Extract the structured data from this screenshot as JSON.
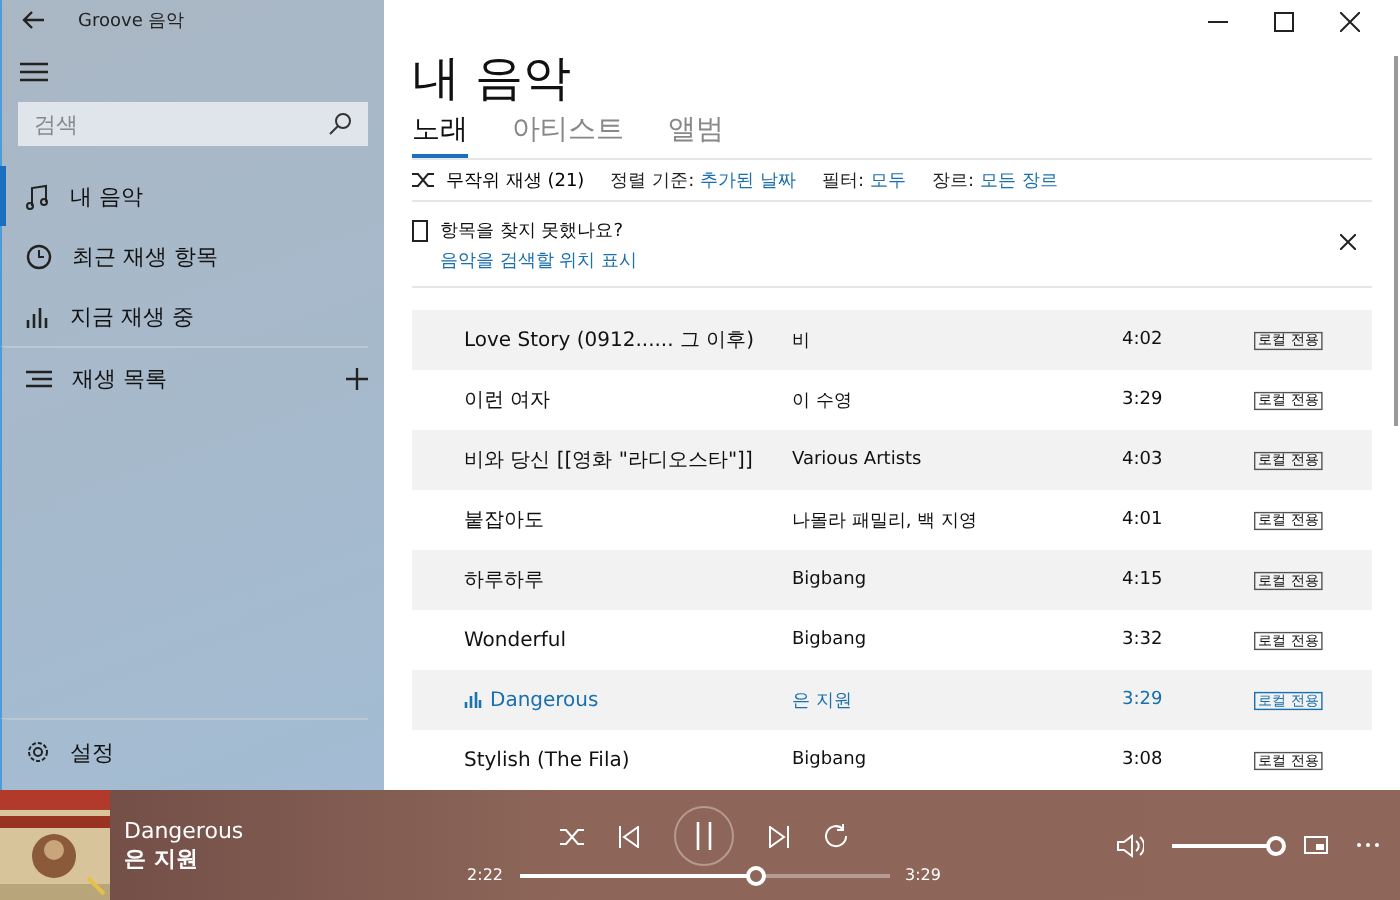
{
  "window": {
    "title": "Groove 음악"
  },
  "sidebar": {
    "search": {
      "placeholder": "검색"
    },
    "items": [
      {
        "label": "내 음악",
        "kind": "note",
        "selected": true
      },
      {
        "label": "최근 재생 항목",
        "kind": "clock",
        "selected": false
      },
      {
        "label": "지금 재생 중",
        "kind": "bars",
        "selected": false
      }
    ],
    "playlists": {
      "label": "재생 목록"
    },
    "settings": {
      "label": "설정"
    }
  },
  "page": {
    "title": "내 음악",
    "tabs": [
      {
        "label": "노래",
        "selected": true
      },
      {
        "label": "아티스트",
        "selected": false
      },
      {
        "label": "앨범",
        "selected": false
      }
    ],
    "toolbar": {
      "shuffle": "무작위 재생 (21)",
      "sort_label": "정렬 기준:",
      "sort_value": "추가된 날짜",
      "filter_label": "필터:",
      "filter_value": "모두",
      "genre_label": "장르:",
      "genre_value": "모든 장르"
    },
    "notice": {
      "text": "항목을 찾지 못했나요?",
      "link": "음악을 검색할 위치 표시"
    }
  },
  "songs": [
    {
      "title": "Love Story (0912...... 그 이후)",
      "artist": "비",
      "duration": "4:02",
      "tag": "로컬 전용",
      "playing": false
    },
    {
      "title": "이런 여자",
      "artist": "이 수영",
      "duration": "3:29",
      "tag": "로컬 전용",
      "playing": false
    },
    {
      "title": "비와 당신 [[영화 \"라디오스타\"]]",
      "artist": "Various Artists",
      "duration": "4:03",
      "tag": "로컬 전용",
      "playing": false
    },
    {
      "title": "붙잡아도",
      "artist": "나몰라 패밀리, 백 지영",
      "duration": "4:01",
      "tag": "로컬 전용",
      "playing": false
    },
    {
      "title": "하루하루",
      "artist": "Bigbang",
      "duration": "4:15",
      "tag": "로컬 전용",
      "playing": false
    },
    {
      "title": "Wonderful",
      "artist": "Bigbang",
      "duration": "3:32",
      "tag": "로컬 전용",
      "playing": false
    },
    {
      "title": "Dangerous",
      "artist": "은 지원",
      "duration": "3:29",
      "tag": "로컬 전용",
      "playing": true
    },
    {
      "title": "Stylish (The Fila)",
      "artist": "Bigbang",
      "duration": "3:08",
      "tag": "로컬 전용",
      "playing": false
    }
  ],
  "player": {
    "title": "Dangerous",
    "artist": "은 지원",
    "elapsed": "2:22",
    "total": "3:29",
    "level": 0.64,
    "volume": {
      "level": 1
    }
  }
}
